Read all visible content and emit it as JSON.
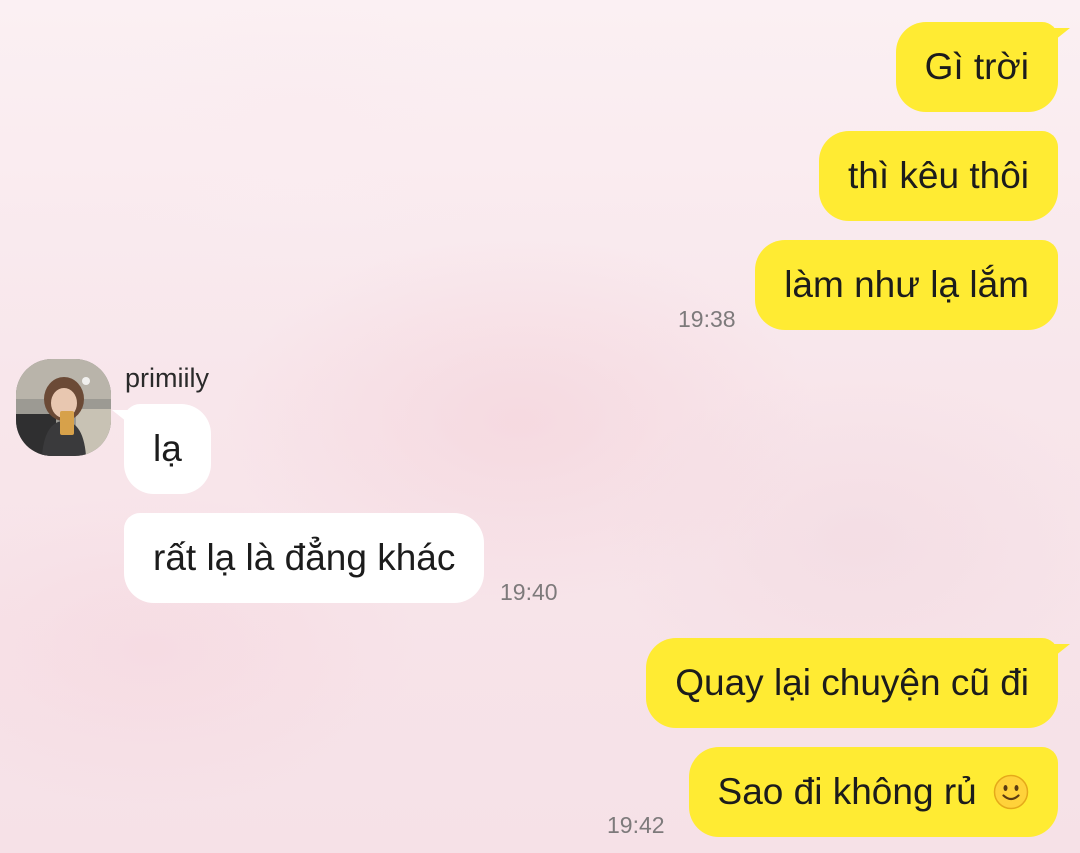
{
  "conversation": {
    "contact_name": "primiily",
    "messages": [
      {
        "direction": "out",
        "text": "Gì trời"
      },
      {
        "direction": "out",
        "text": "thì kêu thôi"
      },
      {
        "direction": "out",
        "text": "làm như lạ lắm",
        "time": "19:38"
      },
      {
        "direction": "in",
        "text": "lạ"
      },
      {
        "direction": "in",
        "text": "rất lạ là đẳng khác",
        "time": "19:40"
      },
      {
        "direction": "out",
        "text": "Quay lại chuyện cũ đi"
      },
      {
        "direction": "out",
        "text": "Sao đi không rủ",
        "emoji": "slightly-smiling-face-icon",
        "time": "19:42"
      }
    ]
  },
  "colors": {
    "outgoing_bubble": "#ffeb33",
    "incoming_bubble": "#ffffff",
    "timestamp": "#7d7a7b",
    "background": "#f8e6eb"
  }
}
